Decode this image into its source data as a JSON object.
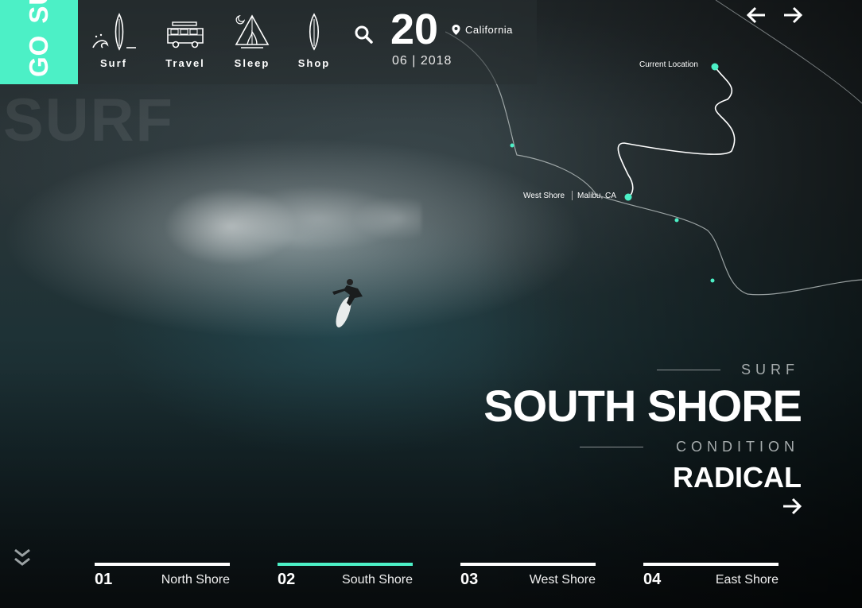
{
  "brand": {
    "go": "GO",
    "surf": "SURF",
    "bg_word": "SURF",
    "accent": "#4cf0c6"
  },
  "nav": {
    "items": [
      {
        "label": "Surf",
        "icon": "surfboard-wave-icon"
      },
      {
        "label": "Travel",
        "icon": "van-icon"
      },
      {
        "label": "Sleep",
        "icon": "campfire-tent-icon"
      },
      {
        "label": "Shop",
        "icon": "surfboard-icon"
      }
    ],
    "search_icon": "search-icon"
  },
  "date": {
    "day": "20",
    "month_year": "06 | 2018",
    "location": "California"
  },
  "map": {
    "current_location": "Current Location",
    "west_shore": "West Shore",
    "malibu": "Malibu, CA"
  },
  "hero": {
    "surf_label": "SURF",
    "title": "SOUTH SHORE",
    "condition_label": "CONDITION",
    "condition_value": "RADICAL"
  },
  "tabs": [
    {
      "num": "01",
      "name": "North Shore",
      "active": false
    },
    {
      "num": "02",
      "name": "South Shore",
      "active": true
    },
    {
      "num": "03",
      "name": "West Shore",
      "active": false
    },
    {
      "num": "04",
      "name": "East Shore",
      "active": false
    }
  ]
}
